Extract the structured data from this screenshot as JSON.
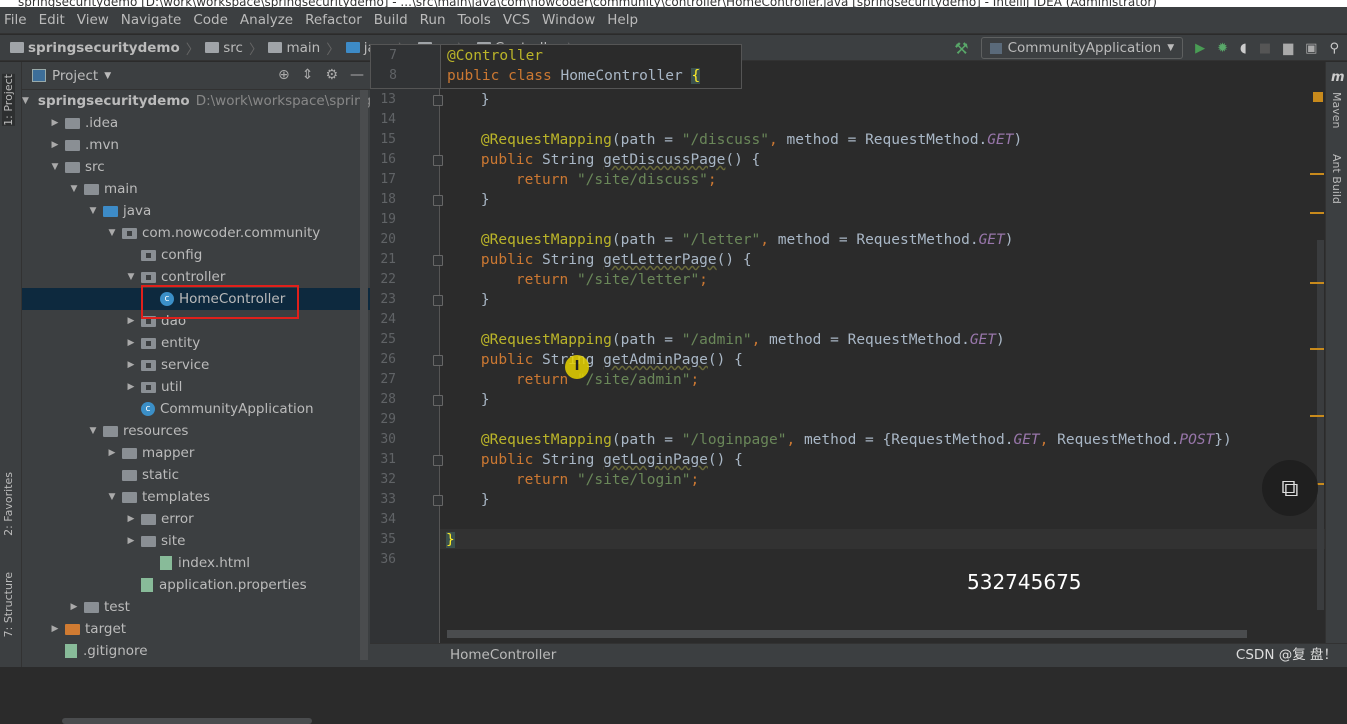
{
  "window": {
    "title": "springsecuritydemo [D:\\work\\workspace\\springsecuritydemo] - ...\\src\\main\\java\\com\\nowcoder\\community\\controller\\HomeController.java [springsecuritydemo] - IntelliJ IDEA (Administrator)"
  },
  "menu": [
    "File",
    "Edit",
    "View",
    "Navigate",
    "Code",
    "Analyze",
    "Refactor",
    "Build",
    "Run",
    "Tools",
    "VCS",
    "Window",
    "Help"
  ],
  "breadcrumb": [
    "springsecuritydemo",
    "src",
    "main",
    "java",
    "co",
    "Controller"
  ],
  "run_config": "CommunityApplication",
  "project_panel": {
    "title": "Project"
  },
  "tree": [
    {
      "label": "springsecuritydemo",
      "extra": "D:\\work\\workspace\\springse",
      "depth": 0,
      "arrow": "open",
      "icon": "folder-module"
    },
    {
      "label": ".idea",
      "depth": 1,
      "arrow": "closed",
      "icon": "folder"
    },
    {
      "label": ".mvn",
      "depth": 1,
      "arrow": "closed",
      "icon": "folder"
    },
    {
      "label": "src",
      "depth": 1,
      "arrow": "open",
      "icon": "folder"
    },
    {
      "label": "main",
      "depth": 2,
      "arrow": "open",
      "icon": "folder"
    },
    {
      "label": "java",
      "depth": 3,
      "arrow": "open",
      "icon": "folder-blue"
    },
    {
      "label": "com.nowcoder.community",
      "depth": 4,
      "arrow": "open",
      "icon": "package"
    },
    {
      "label": "config",
      "depth": 5,
      "arrow": "none",
      "icon": "package"
    },
    {
      "label": "controller",
      "depth": 5,
      "arrow": "open",
      "icon": "package"
    },
    {
      "label": "HomeController",
      "depth": 6,
      "arrow": "none",
      "icon": "class",
      "selected": true
    },
    {
      "label": "dao",
      "depth": 5,
      "arrow": "closed",
      "icon": "package"
    },
    {
      "label": "entity",
      "depth": 5,
      "arrow": "closed",
      "icon": "package"
    },
    {
      "label": "service",
      "depth": 5,
      "arrow": "closed",
      "icon": "package"
    },
    {
      "label": "util",
      "depth": 5,
      "arrow": "closed",
      "icon": "package"
    },
    {
      "label": "CommunityApplication",
      "depth": 5,
      "arrow": "none",
      "icon": "class"
    },
    {
      "label": "resources",
      "depth": 3,
      "arrow": "open",
      "icon": "folder"
    },
    {
      "label": "mapper",
      "depth": 4,
      "arrow": "closed",
      "icon": "folder"
    },
    {
      "label": "static",
      "depth": 4,
      "arrow": "none",
      "icon": "folder"
    },
    {
      "label": "templates",
      "depth": 4,
      "arrow": "open",
      "icon": "folder"
    },
    {
      "label": "error",
      "depth": 5,
      "arrow": "closed",
      "icon": "folder"
    },
    {
      "label": "site",
      "depth": 5,
      "arrow": "closed",
      "icon": "folder"
    },
    {
      "label": "index.html",
      "depth": 6,
      "arrow": "none",
      "icon": "file"
    },
    {
      "label": "application.properties",
      "depth": 5,
      "arrow": "none",
      "icon": "file"
    },
    {
      "label": "test",
      "depth": 2,
      "arrow": "closed",
      "icon": "folder"
    },
    {
      "label": "target",
      "depth": 1,
      "arrow": "closed",
      "icon": "folder-orange"
    },
    {
      "label": ".gitignore",
      "depth": 1,
      "arrow": "none",
      "icon": "file"
    }
  ],
  "left_tabs": [
    "1: Project",
    "2: Favorites",
    "7: Structure"
  ],
  "right_tabs": [
    "Maven",
    "Ant Build"
  ],
  "popup_lines": [
    {
      "n": "7",
      "tokens": [
        [
          "an",
          "@Controller"
        ]
      ]
    },
    {
      "n": "8",
      "tokens": [
        [
          "kw",
          "public class "
        ],
        [
          "",
          "HomeController "
        ],
        [
          "br",
          "{"
        ]
      ]
    }
  ],
  "code_lines": [
    {
      "n": "13",
      "tokens": [
        [
          "",
          "    }"
        ]
      ]
    },
    {
      "n": "14",
      "tokens": []
    },
    {
      "n": "15",
      "tokens": [
        [
          "an",
          "    @RequestMapping"
        ],
        [
          "",
          "(path = "
        ],
        [
          "st",
          "\"/discuss\""
        ],
        [
          "kw",
          ", "
        ],
        [
          "",
          "method = RequestMethod."
        ],
        [
          "it",
          "GET"
        ],
        [
          "",
          ")"
        ]
      ]
    },
    {
      "n": "16",
      "tokens": [
        [
          "kw",
          "    public "
        ],
        [
          "",
          "String "
        ],
        [
          "fn",
          "getDiscussPage"
        ],
        [
          "",
          "() {"
        ]
      ]
    },
    {
      "n": "17",
      "tokens": [
        [
          "kw",
          "        return "
        ],
        [
          "st",
          "\"/site/discuss\""
        ],
        [
          "kw",
          ";"
        ]
      ]
    },
    {
      "n": "18",
      "tokens": [
        [
          "",
          "    }"
        ]
      ]
    },
    {
      "n": "19",
      "tokens": []
    },
    {
      "n": "20",
      "tokens": [
        [
          "an",
          "    @RequestMapping"
        ],
        [
          "",
          "(path = "
        ],
        [
          "st",
          "\"/letter\""
        ],
        [
          "kw",
          ", "
        ],
        [
          "",
          "method = RequestMethod."
        ],
        [
          "it",
          "GET"
        ],
        [
          "",
          ")"
        ]
      ]
    },
    {
      "n": "21",
      "tokens": [
        [
          "kw",
          "    public "
        ],
        [
          "",
          "String "
        ],
        [
          "fn",
          "getLetterPage"
        ],
        [
          "",
          "() {"
        ]
      ]
    },
    {
      "n": "22",
      "tokens": [
        [
          "kw",
          "        return "
        ],
        [
          "st",
          "\"/site/letter\""
        ],
        [
          "kw",
          ";"
        ]
      ]
    },
    {
      "n": "23",
      "tokens": [
        [
          "",
          "    }"
        ]
      ]
    },
    {
      "n": "24",
      "tokens": []
    },
    {
      "n": "25",
      "tokens": [
        [
          "an",
          "    @RequestMapping"
        ],
        [
          "",
          "(path = "
        ],
        [
          "st",
          "\"/admin\""
        ],
        [
          "kw",
          ", "
        ],
        [
          "",
          "method = RequestMethod."
        ],
        [
          "it",
          "GET"
        ],
        [
          "",
          ")"
        ]
      ]
    },
    {
      "n": "26",
      "tokens": [
        [
          "kw",
          "    public "
        ],
        [
          "",
          "String "
        ],
        [
          "fn",
          "getAdminPage"
        ],
        [
          "",
          "() {"
        ]
      ]
    },
    {
      "n": "27",
      "tokens": [
        [
          "kw",
          "        return "
        ],
        [
          "st",
          "\"/site/admin\""
        ],
        [
          "kw",
          ";"
        ]
      ]
    },
    {
      "n": "28",
      "tokens": [
        [
          "",
          "    }"
        ]
      ]
    },
    {
      "n": "29",
      "tokens": []
    },
    {
      "n": "30",
      "tokens": [
        [
          "an",
          "    @RequestMapping"
        ],
        [
          "",
          "(path = "
        ],
        [
          "st",
          "\"/loginpage\""
        ],
        [
          "kw",
          ", "
        ],
        [
          "",
          "method = {RequestMethod."
        ],
        [
          "it",
          "GET"
        ],
        [
          "kw",
          ", "
        ],
        [
          "",
          "RequestMethod."
        ],
        [
          "it",
          "POST"
        ],
        [
          "",
          "})"
        ]
      ]
    },
    {
      "n": "31",
      "tokens": [
        [
          "kw",
          "    public "
        ],
        [
          "",
          "String "
        ],
        [
          "fn",
          "getLoginPage"
        ],
        [
          "",
          "() {"
        ]
      ]
    },
    {
      "n": "32",
      "tokens": [
        [
          "kw",
          "        return "
        ],
        [
          "st",
          "\"/site/login\""
        ],
        [
          "kw",
          ";"
        ]
      ]
    },
    {
      "n": "33",
      "tokens": [
        [
          "",
          "    }"
        ]
      ]
    },
    {
      "n": "34",
      "tokens": []
    },
    {
      "n": "35",
      "tokens": [
        [
          "br",
          "}"
        ]
      ]
    },
    {
      "n": "36",
      "tokens": []
    }
  ],
  "status": {
    "file": "HomeController",
    "watermark": "CSDN @复 盘！"
  },
  "overlay_number": "532745675",
  "colors": {
    "selection_box": "#e0201b",
    "accent": "#3d8bc7"
  }
}
